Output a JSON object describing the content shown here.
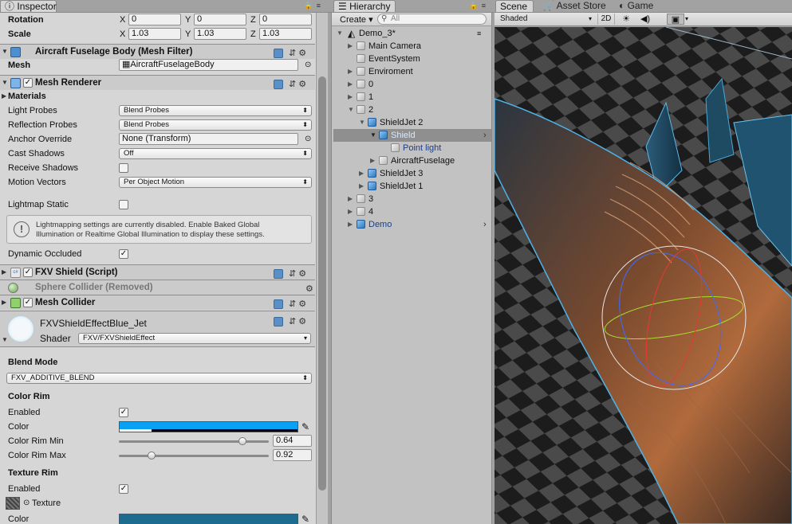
{
  "tabs": {
    "inspector": "Inspector",
    "hierarchy": "Hierarchy",
    "scene": "Scene",
    "asset_store": "Asset Store",
    "game": "Game"
  },
  "transform": {
    "rotation_label": "Rotation",
    "scale_label": "Scale",
    "x": "X",
    "y": "Y",
    "z": "Z",
    "rotation": [
      "0",
      "0",
      "0"
    ],
    "scale": [
      "1.03",
      "1.03",
      "1.03"
    ]
  },
  "mesh_filter": {
    "title": "Aircraft Fuselage Body (Mesh Filter)",
    "mesh_label": "Mesh",
    "mesh_value": "AircraftFuselageBody"
  },
  "mesh_renderer": {
    "title": "Mesh Renderer",
    "materials_label": "Materials",
    "light_probes_label": "Light Probes",
    "light_probes": "Blend Probes",
    "reflection_probes_label": "Reflection Probes",
    "reflection_probes": "Blend Probes",
    "anchor_override_label": "Anchor Override",
    "anchor_override": "None (Transform)",
    "cast_shadows_label": "Cast Shadows",
    "cast_shadows": "Off",
    "receive_shadows_label": "Receive Shadows",
    "motion_vectors_label": "Motion Vectors",
    "motion_vectors": "Per Object Motion",
    "lightmap_static_label": "Lightmap Static",
    "info_line1": "Lightmapping settings are currently disabled. Enable Baked Global",
    "info_line2": "Illumination or Realtime Global Illumination to display these settings.",
    "dynamic_occluded_label": "Dynamic Occluded"
  },
  "fxv_shield": {
    "title": "FXV Shield (Script)"
  },
  "sphere_collider": {
    "title": "Sphere Collider (Removed)"
  },
  "mesh_collider": {
    "title": "Mesh Collider"
  },
  "material": {
    "name": "FXVShieldEffectBlue_Jet",
    "shader_label": "Shader",
    "shader": "FXV/FXVShieldEffect",
    "blend_mode_label": "Blend Mode",
    "blend_mode": "FXV_ADDITIVE_BLEND",
    "color_rim_label": "Color Rim",
    "enabled_label": "Enabled",
    "color_label": "Color",
    "rim_min_label": "Color Rim Min",
    "rim_min": "0.64",
    "rim_max_label": "Color Rim Max",
    "rim_max": "0.92",
    "rim_min_value": 0.64,
    "rim_max_value": 0.92,
    "texture_rim_label": "Texture Rim",
    "tex_enabled_label": "Enabled",
    "texture_label": "Texture",
    "tex_color_label": "Color",
    "rim_color": "#0aa0f5",
    "tex_color": "#1d6b8e"
  },
  "hierarchy": {
    "create": "Create",
    "search_placeholder": "All",
    "scene_name": "Demo_3*",
    "items": [
      {
        "label": "Main Camera"
      },
      {
        "label": "EventSystem"
      },
      {
        "label": "Enviroment"
      },
      {
        "label": "0"
      },
      {
        "label": "1"
      },
      {
        "label": "2"
      },
      {
        "label": "ShieldJet 2"
      },
      {
        "label": "Shield"
      },
      {
        "label": "Point light"
      },
      {
        "label": "AircraftFuselage"
      },
      {
        "label": "ShieldJet 3"
      },
      {
        "label": "ShieldJet 1"
      },
      {
        "label": "3"
      },
      {
        "label": "4"
      },
      {
        "label": "Demo"
      }
    ]
  },
  "scene": {
    "shading_mode": "Shaded",
    "mode_2d": "2D"
  }
}
